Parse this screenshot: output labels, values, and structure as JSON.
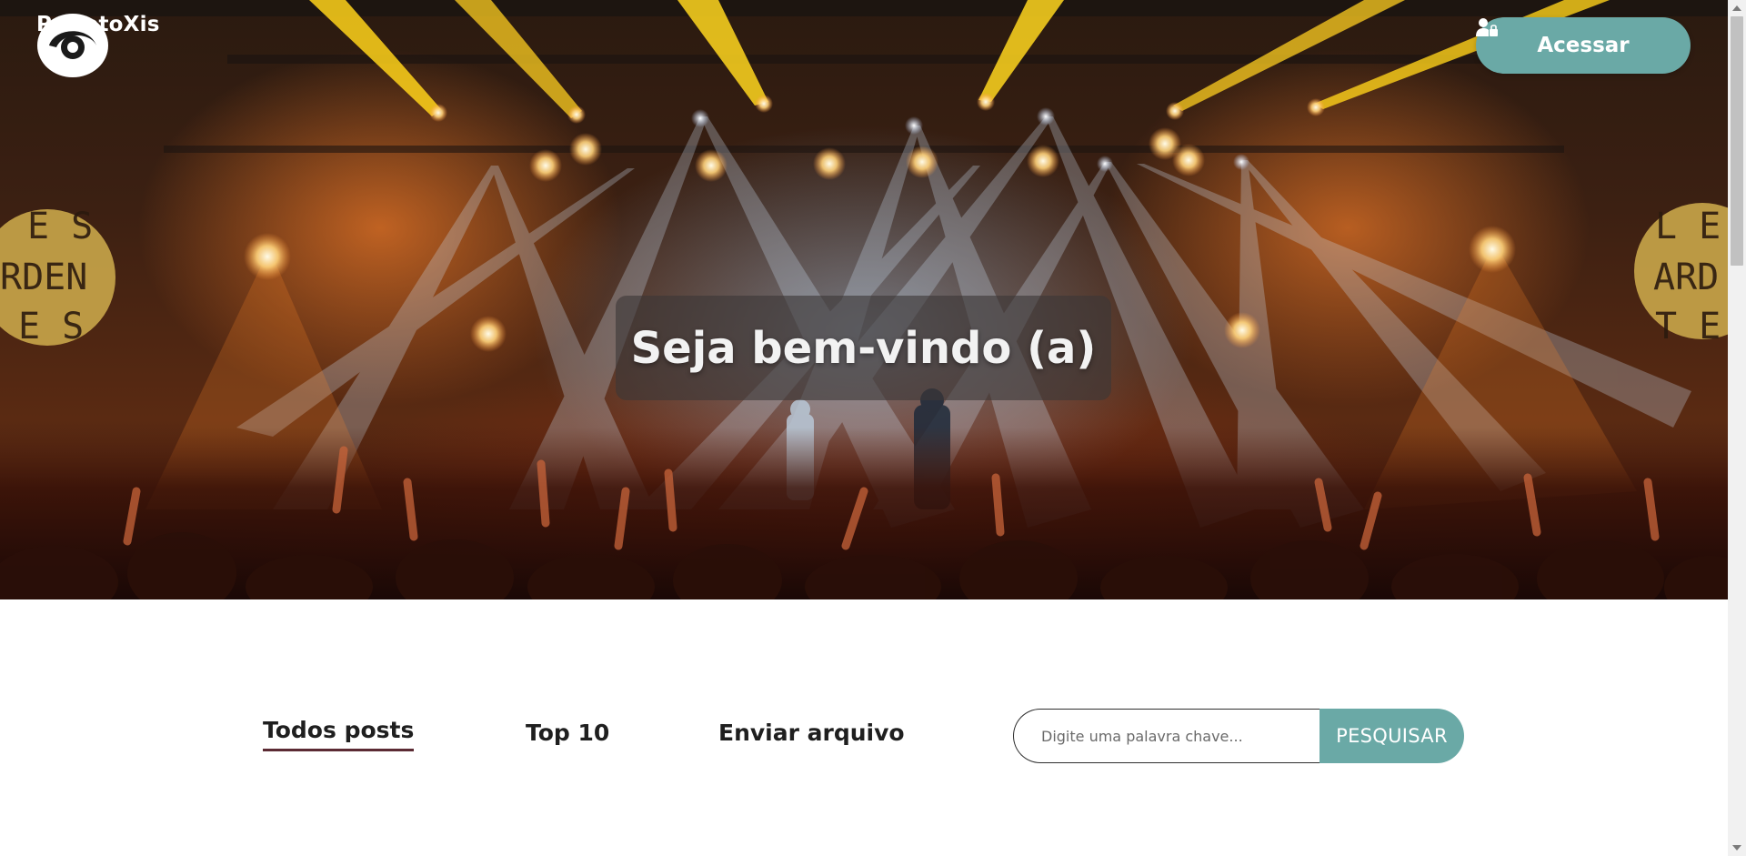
{
  "header": {
    "brand_name": "ProjetoXis",
    "logo_icon": "eye-logo-icon",
    "login_button_label": "Acessar",
    "login_icon": "user-lock-icon"
  },
  "hero": {
    "welcome_text": "Seja bem-vindo (a)",
    "background_image": "concert-stage-crowd-photo"
  },
  "nav": {
    "tabs": [
      {
        "label": "Todos posts",
        "active": true
      },
      {
        "label": "Top 10",
        "active": false
      },
      {
        "label": "Enviar arquivo",
        "active": false
      }
    ]
  },
  "search": {
    "placeholder": "Digite uma palavra chave...",
    "value": "",
    "button_label": "PESQUISAR"
  },
  "colors": {
    "accent": "#6aa9a6",
    "active_tab_underline": "#5b2a33",
    "text": "#1f1f1f"
  }
}
